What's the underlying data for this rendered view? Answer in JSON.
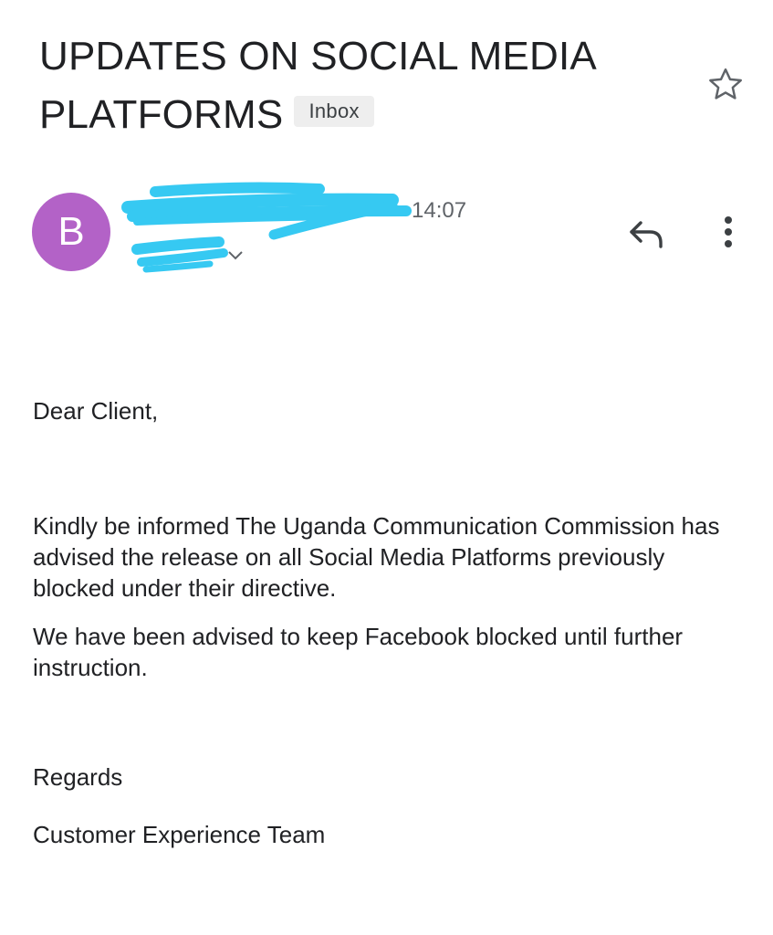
{
  "email": {
    "subject": "UPDATES ON SOCIAL MEDIA PLATFORMS",
    "label": "Inbox",
    "sender_initial": "B",
    "time": "14:07",
    "body": {
      "greeting": "Dear Client,",
      "paragraph1": "Kindly be informed The Uganda Communication Commission has advised the release on all Social Media Platforms previously blocked under their directive.",
      "paragraph2": "We have been advised to keep Facebook blocked until further instruction.",
      "closing": "Regards",
      "signature": "Customer Experience Team"
    }
  },
  "icons": {
    "star": "star-outline-icon",
    "reply": "reply-icon",
    "more": "more-vert-icon",
    "expand": "chevron-down-icon"
  },
  "colors": {
    "avatar": "#b362c7",
    "redaction": "#36c9f2",
    "label_chip_bg": "#eeeeee",
    "secondary_text": "#5f6368"
  }
}
